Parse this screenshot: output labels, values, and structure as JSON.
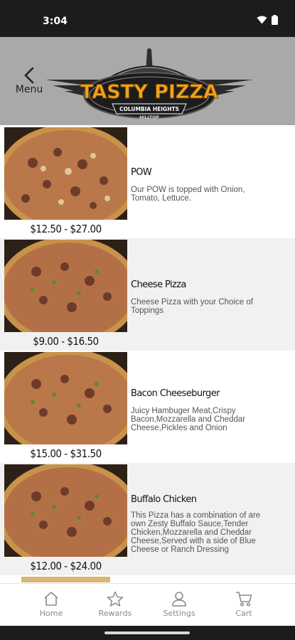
{
  "status_bar": {
    "time": "3:04",
    "icons": [
      "wifi-icon",
      "battery-icon"
    ]
  },
  "header": {
    "back_label": "Menu",
    "logo": {
      "brand": "TASTY PIZZA",
      "line1": "COLUMBIA HEIGHTS",
      "line2": "HILLTOP"
    }
  },
  "menu_items": [
    {
      "name": "POW",
      "price": "$12.50 - $27.00",
      "description": [
        "Our POW is topped with Onion,",
        "Tomato, Lettuce."
      ]
    },
    {
      "name": "Cheese Pizza",
      "price": "$9.00 - $16.50",
      "description": [
        "Cheese Pizza with your Choice of",
        "Toppings"
      ]
    },
    {
      "name": "Bacon Cheeseburger",
      "price": "$15.00 - $31.50",
      "description": [
        "Juicy Hambuger Meat,Crispy",
        "Bacon,Mozzarella and Cheddar",
        "Cheese,Pickles and Onion"
      ]
    },
    {
      "name": "Buffalo Chicken",
      "price": "$12.00 - $24.00",
      "description": [
        "This Pizza has a combination of are",
        "own Zesty Buffalo Sauce,Tender",
        "Chicken,Mozzarella and Cheddar",
        "Cheese,Served with a side of Blue",
        "Cheese or Ranch Dressing"
      ]
    }
  ],
  "tab_bar": {
    "tabs": [
      {
        "label": "Home",
        "icon": "home-icon"
      },
      {
        "label": "Rewards",
        "icon": "star-icon"
      },
      {
        "label": "Settings",
        "icon": "person-icon"
      },
      {
        "label": "Cart",
        "icon": "cart-icon"
      }
    ]
  },
  "colors": {
    "header_bg": "#a9a9a9",
    "status_bg": "#1c1c1c",
    "alt_row_bg": "#f1f1f1",
    "logo_orange": "#f2a21e",
    "tab_gray": "#8a8a8a"
  }
}
